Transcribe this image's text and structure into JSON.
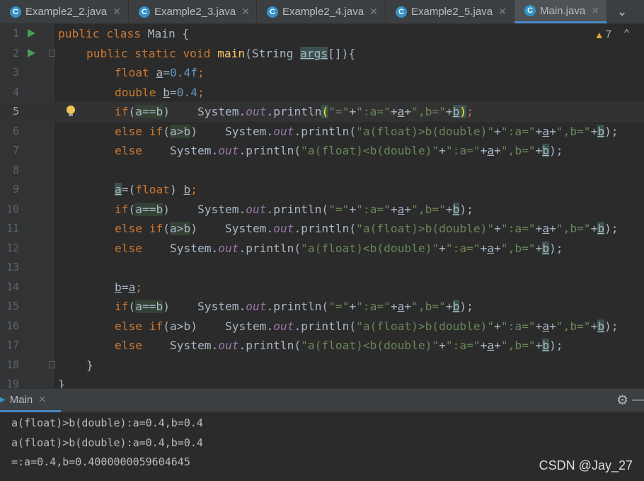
{
  "tabs": [
    {
      "label": "Example2_2.java",
      "icon": "C",
      "close": "✕"
    },
    {
      "label": "Example2_3.java",
      "icon": "C",
      "close": "✕"
    },
    {
      "label": "Example2_4.java",
      "icon": "C",
      "close": "✕"
    },
    {
      "label": "Example2_5.java",
      "icon": "C",
      "close": "✕"
    },
    {
      "label": "Main.java",
      "icon": "C",
      "close": "✕"
    }
  ],
  "tab_overflow": "⌄",
  "editor": {
    "warning_icon": "▲",
    "warning_count": "7",
    "nav_up": "⌃",
    "line_numbers": [
      "1",
      "2",
      "3",
      "4",
      "5",
      "6",
      "7",
      "8",
      "9",
      "10",
      "11",
      "12",
      "13",
      "14",
      "15",
      "16",
      "17",
      "18",
      "19"
    ],
    "code": {
      "l1_kw": "public class",
      "l1_cls": "Main {",
      "l2_kw": "public static void",
      "l2_fn": "main",
      "l2_p1": "(String",
      "l2_args": "args",
      "l2_p2": "[]){",
      "l3_kw": "float",
      "l3_var": "a",
      "l3_eq": "=",
      "l3_num": "0.4f",
      "l3_semi": ";",
      "l4_kw": "double",
      "l4_var": "b",
      "l4_eq": "=",
      "l4_num": "0.4",
      "l4_semi": ";",
      "kw_if": "if",
      "kw_else": "else",
      "kw_elseif": "else if",
      "cond_eq_a": "a",
      "cond_eq_op": "==",
      "cond_eq_b": "b",
      "cond_gt_a": "a",
      "cond_gt_op": ">",
      "cond_gt_b": "b",
      "sys": "System.",
      "out": "out",
      "println": ".println(",
      "str_eq": "\"=\"",
      "str_gt": "\"a(float)>b(double)\"",
      "str_lt": "\"a(float)<b(double)\"",
      "plus": "+",
      "str_a": "\":a=\"",
      "var_a": "a",
      "str_b": "\",b=\"",
      "var_b": "b",
      "close": ");",
      "l9_a": "a",
      "l9_mid": "=(",
      "l9_kw": "float",
      "l9_rp": ") ",
      "l9_b": "b",
      "l9_semi": ";",
      "l14_b": "b",
      "l14_eq": "=",
      "l14_a": "a",
      "l14_semi": ";",
      "l18": "}",
      "l19": "}"
    }
  },
  "run_panel": {
    "tab_icon": "▶",
    "tab_label": "Main",
    "tab_close": "✕",
    "gear_icon": "⚙",
    "minimize_icon": "—",
    "output": [
      "a(float)>b(double):a=0.4,b=0.4",
      "a(float)>b(double):a=0.4,b=0.4",
      "=:a=0.4,b=0.4000000059604645"
    ]
  },
  "watermark": "CSDN @Jay_27"
}
